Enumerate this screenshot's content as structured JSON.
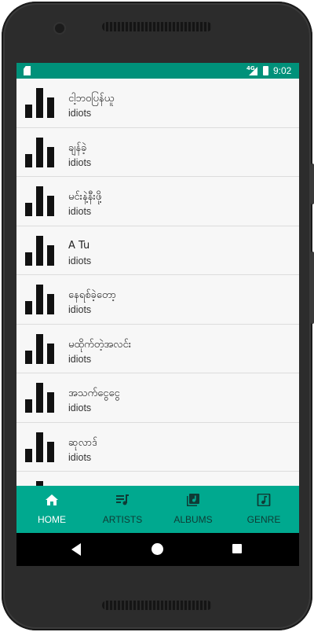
{
  "status_bar": {
    "time": "9:02",
    "network": "4G"
  },
  "songs": [
    {
      "title": "ငါ့ဘဝပြန်ယူ",
      "artist": "idiots"
    },
    {
      "title": "ချန်ခဲ့",
      "artist": "idiots"
    },
    {
      "title": "မင်းနဲ့နီးဖို့",
      "artist": "idiots"
    },
    {
      "title": "A Tu",
      "artist": "idiots"
    },
    {
      "title": "နေရစ်ခဲ့တော့",
      "artist": "idiots"
    },
    {
      "title": "မထိုက်တဲ့အလင်း",
      "artist": "idiots"
    },
    {
      "title": "အသက်ငွေငွေ",
      "artist": "idiots"
    },
    {
      "title": "ဆုလာဒ်",
      "artist": "idiots"
    }
  ],
  "tabs": [
    {
      "label": "HOME",
      "icon": "home-icon",
      "active": true
    },
    {
      "label": "ARTISTS",
      "icon": "playlist-icon",
      "active": false
    },
    {
      "label": "ALBUMS",
      "icon": "album-library-icon",
      "active": false
    },
    {
      "label": "GENRE",
      "icon": "music-note-icon",
      "active": false
    }
  ],
  "colors": {
    "status_bar": "#00917a",
    "bottom_nav": "#00a98f",
    "active_tab": "#ffffff",
    "inactive_tab": "#0f3b35"
  }
}
